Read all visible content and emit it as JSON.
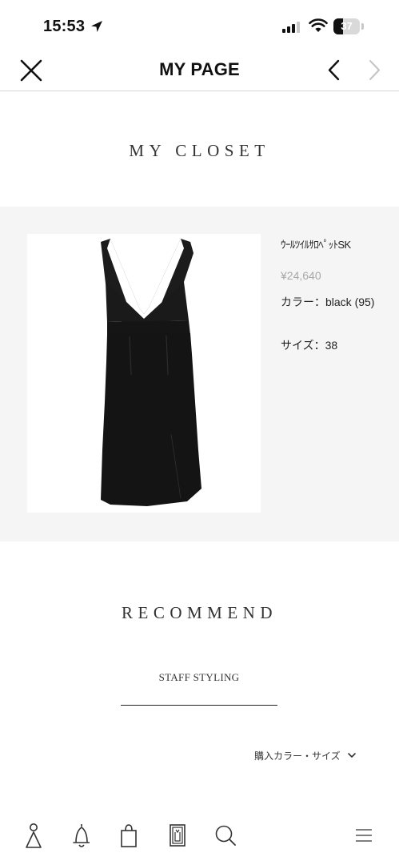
{
  "status_bar": {
    "time": "15:53",
    "battery_level": "37",
    "battery_fraction": 0.37
  },
  "header": {
    "title": "MY PAGE"
  },
  "closet": {
    "title": "MY CLOSET",
    "product": {
      "name": "ｳｰﾙﾂｲﾙｻﾛﾍﾟｯﾄSK",
      "price": "¥24,640",
      "color": "カラー：black (95)",
      "size": "サイズ：38"
    }
  },
  "recommend": {
    "title": "RECOMMEND",
    "tab_label": "STAFF STYLING",
    "filter_label": "購入カラー・サイズ"
  },
  "icons": {
    "close": "close-icon",
    "prev": "chevron-left-icon",
    "next": "chevron-right-icon",
    "filter": "chevron-down-icon",
    "nav": [
      "user-icon",
      "bell-icon",
      "shopping-bag-icon",
      "closet-icon",
      "search-icon",
      "menu-icon"
    ]
  },
  "colors": {
    "background": "#ffffff",
    "card_background": "#f5f5f5",
    "text": "#222222",
    "muted_price": "#a8a8a8",
    "next_disabled": "#c4c4c4"
  }
}
